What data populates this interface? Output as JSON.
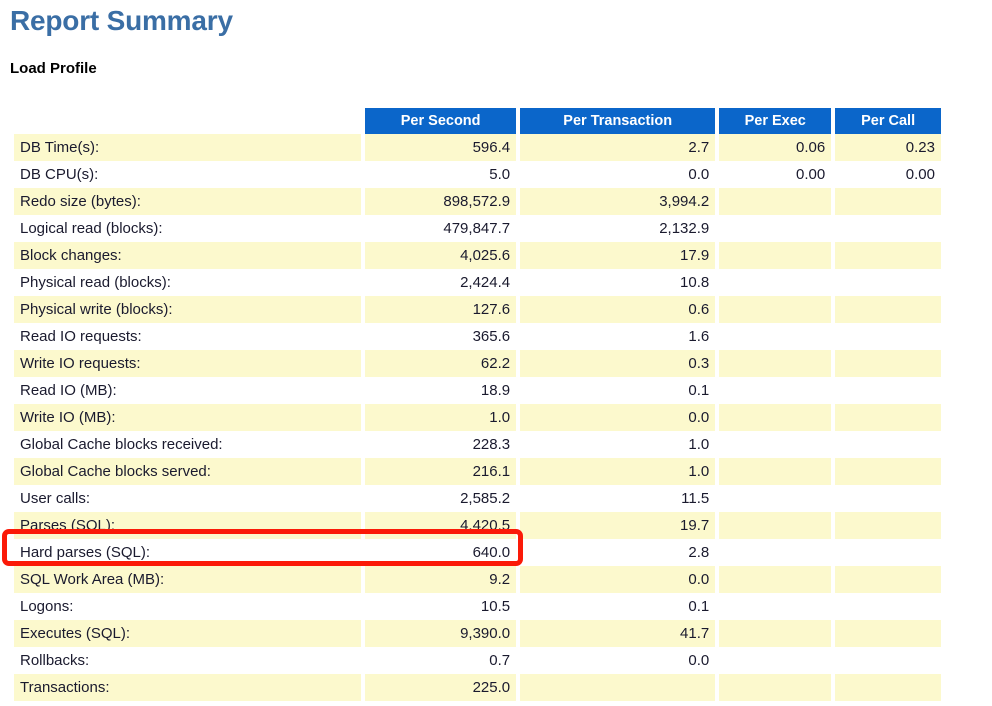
{
  "page": {
    "title": "Report Summary",
    "section_title": "Load Profile"
  },
  "colors": {
    "title_blue": "#3a6ea5",
    "header_blue": "#0b66ca",
    "row_yellow": "#fcf9cd",
    "row_white": "#ffffff",
    "highlight_red": "#fb1a08"
  },
  "table": {
    "columns": [
      "",
      "Per Second",
      "Per Transaction",
      "Per Exec",
      "Per Call"
    ],
    "rows": [
      {
        "label": "DB Time(s):",
        "per_second": "596.4",
        "per_transaction": "2.7",
        "per_exec": "0.06",
        "per_call": "0.23"
      },
      {
        "label": "DB CPU(s):",
        "per_second": "5.0",
        "per_transaction": "0.0",
        "per_exec": "0.00",
        "per_call": "0.00"
      },
      {
        "label": "Redo size (bytes):",
        "per_second": "898,572.9",
        "per_transaction": "3,994.2",
        "per_exec": "",
        "per_call": ""
      },
      {
        "label": "Logical read (blocks):",
        "per_second": "479,847.7",
        "per_transaction": "2,132.9",
        "per_exec": "",
        "per_call": ""
      },
      {
        "label": "Block changes:",
        "per_second": "4,025.6",
        "per_transaction": "17.9",
        "per_exec": "",
        "per_call": ""
      },
      {
        "label": "Physical read (blocks):",
        "per_second": "2,424.4",
        "per_transaction": "10.8",
        "per_exec": "",
        "per_call": ""
      },
      {
        "label": "Physical write (blocks):",
        "per_second": "127.6",
        "per_transaction": "0.6",
        "per_exec": "",
        "per_call": ""
      },
      {
        "label": "Read IO requests:",
        "per_second": "365.6",
        "per_transaction": "1.6",
        "per_exec": "",
        "per_call": ""
      },
      {
        "label": "Write IO requests:",
        "per_second": "62.2",
        "per_transaction": "0.3",
        "per_exec": "",
        "per_call": ""
      },
      {
        "label": "Read IO (MB):",
        "per_second": "18.9",
        "per_transaction": "0.1",
        "per_exec": "",
        "per_call": ""
      },
      {
        "label": "Write IO (MB):",
        "per_second": "1.0",
        "per_transaction": "0.0",
        "per_exec": "",
        "per_call": ""
      },
      {
        "label": "Global Cache blocks received:",
        "per_second": "228.3",
        "per_transaction": "1.0",
        "per_exec": "",
        "per_call": ""
      },
      {
        "label": "Global Cache blocks served:",
        "per_second": "216.1",
        "per_transaction": "1.0",
        "per_exec": "",
        "per_call": ""
      },
      {
        "label": "User calls:",
        "per_second": "2,585.2",
        "per_transaction": "11.5",
        "per_exec": "",
        "per_call": ""
      },
      {
        "label": "Parses (SQL):",
        "per_second": "4,420.5",
        "per_transaction": "19.7",
        "per_exec": "",
        "per_call": ""
      },
      {
        "label": "Hard parses (SQL):",
        "per_second": "640.0",
        "per_transaction": "2.8",
        "per_exec": "",
        "per_call": ""
      },
      {
        "label": "SQL Work Area (MB):",
        "per_second": "9.2",
        "per_transaction": "0.0",
        "per_exec": "",
        "per_call": ""
      },
      {
        "label": "Logons:",
        "per_second": "10.5",
        "per_transaction": "0.1",
        "per_exec": "",
        "per_call": ""
      },
      {
        "label": "Executes (SQL):",
        "per_second": "9,390.0",
        "per_transaction": "41.7",
        "per_exec": "",
        "per_call": ""
      },
      {
        "label": "Rollbacks:",
        "per_second": "0.7",
        "per_transaction": "0.0",
        "per_exec": "",
        "per_call": ""
      },
      {
        "label": "Transactions:",
        "per_second": "225.0",
        "per_transaction": "",
        "per_exec": "",
        "per_call": ""
      }
    ],
    "highlighted_row_label": "Hard parses (SQL):"
  }
}
